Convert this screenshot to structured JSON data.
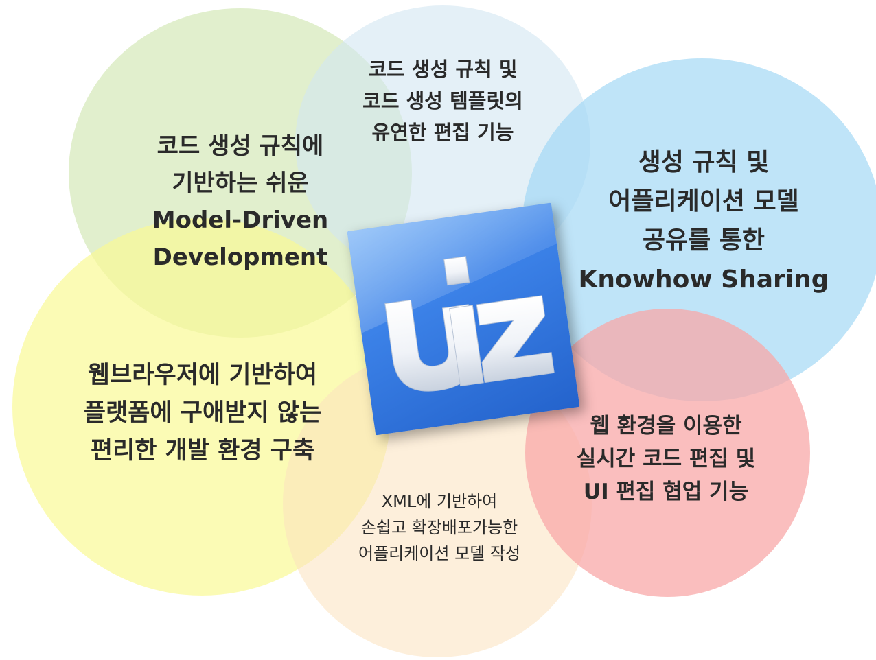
{
  "colors": {
    "green_circle": "#cde4ac",
    "top_circle": "#d2e6f2",
    "blue_circle": "#a0d7f5",
    "yellow_circle": "#fafa96",
    "peach_circle": "#fce2be",
    "pink_circle": "#f8a8a8",
    "logo_blue": "#3c82e8",
    "text": "#2a2a2a"
  },
  "logo": {
    "icon": "uiz-logo-icon",
    "text": "uiz"
  },
  "bubbles": {
    "green": {
      "lines": [
        "코드 생성 규칙에",
        "기반하는 쉬운",
        "Model-Driven",
        "Development"
      ]
    },
    "top": {
      "lines": [
        "코드 생성 규칙 및",
        "코드 생성 템플릿의",
        "유연한 편집 기능"
      ]
    },
    "blue": {
      "lines": [
        "생성 규칙 및",
        "어플리케이션 모델",
        "공유를 통한",
        "Knowhow Sharing"
      ]
    },
    "yellow": {
      "lines": [
        "웹브라우저에 기반하여",
        "플랫폼에 구애받지 않는",
        "편리한 개발 환경 구축"
      ]
    },
    "peach": {
      "lines": [
        "XML에 기반하여",
        "손쉽고 확장배포가능한",
        "어플리케이션 모델 작성"
      ]
    },
    "pink": {
      "lines": [
        "웹 환경을 이용한",
        "실시간 코드 편집 및",
        "UI 편집 협업 기능"
      ]
    }
  }
}
